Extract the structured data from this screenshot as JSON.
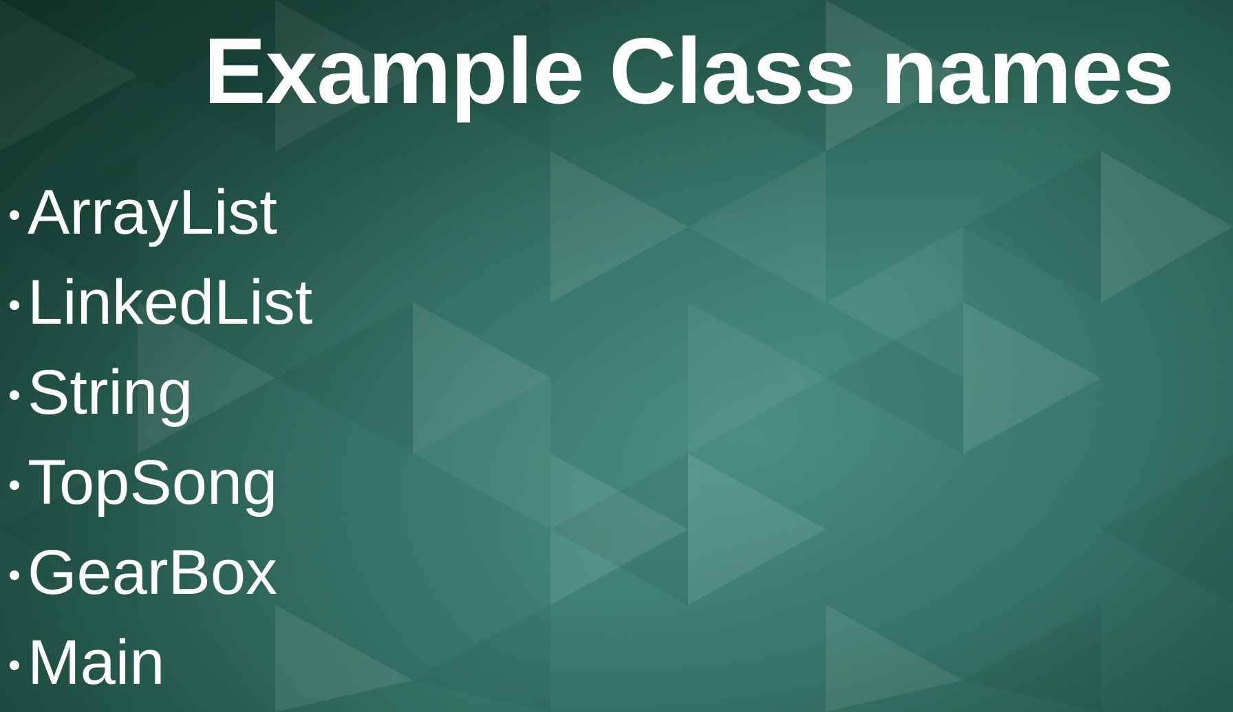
{
  "slide": {
    "title": "Example Class names",
    "items": [
      {
        "label": "ArrayList"
      },
      {
        "label": "LinkedList"
      },
      {
        "label": "String"
      },
      {
        "label": "TopSong"
      },
      {
        "label": "GearBox"
      },
      {
        "label": "Main"
      }
    ]
  },
  "colors": {
    "background_dark": "#163d32",
    "background_mid": "#316d5f",
    "background_light": "#4a8f80",
    "text": "#ffffff"
  }
}
